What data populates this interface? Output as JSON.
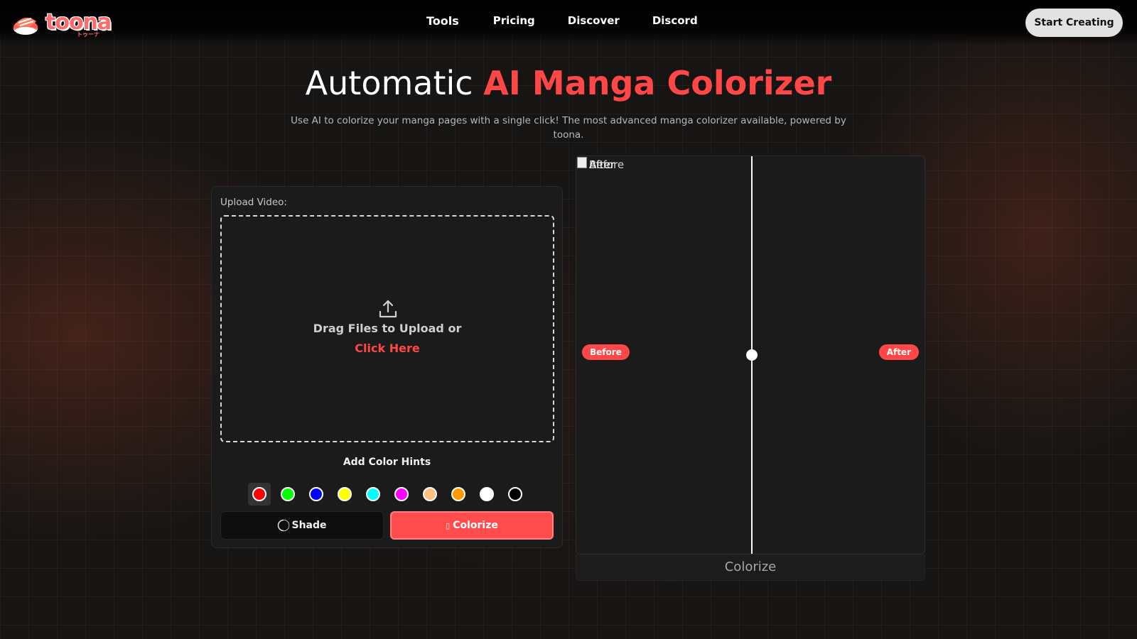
{
  "brand": {
    "name": "toona",
    "sub": "トゥーナ"
  },
  "nav": {
    "links": [
      "Tools",
      "Pricing",
      "Discover",
      "Discord"
    ],
    "cta": "Start Creating"
  },
  "hero": {
    "title_plain": "Automatic ",
    "title_accent": "AI Manga Colorizer",
    "subtitle": "Use AI to colorize your manga pages with a single click! The most advanced manga colorizer available, powered by toona."
  },
  "upload": {
    "label": "Upload Video:",
    "drag_text": "Drag Files to Upload or",
    "click_text": "Click Here"
  },
  "hints": {
    "label": "Add Color Hints",
    "colors": [
      "#ff0000",
      "#00ff00",
      "#0000ff",
      "#ffff00",
      "#00ffff",
      "#ff00ff",
      "#ffc080",
      "#ff9900",
      "#ffffff",
      "#000000"
    ],
    "selected_index": 0
  },
  "actions": {
    "shade": "Shade",
    "colorize": "Colorize"
  },
  "compare": {
    "alt_after": "After",
    "alt_before": "Before",
    "before_label": "Before",
    "after_label": "After",
    "slider_position": 0.5,
    "footer": "Colorize"
  },
  "colors": {
    "accent": "#ff4747",
    "cta_bg": "#e2e2e2",
    "panel_bg": "#1b1b1b"
  }
}
